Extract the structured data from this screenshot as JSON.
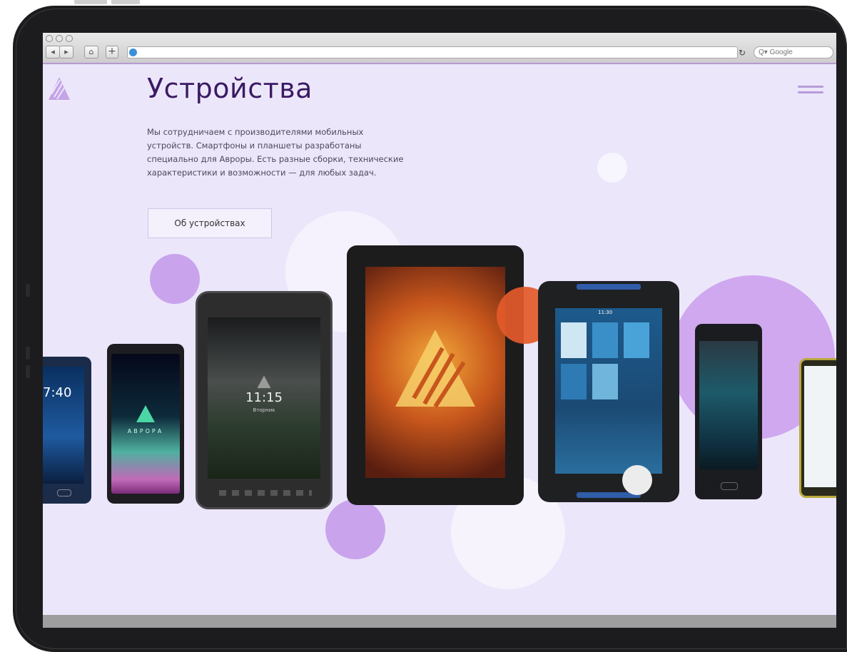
{
  "browser": {
    "search_placeholder": "Q▾ Google"
  },
  "page": {
    "title": "Устройства",
    "description": "Мы сотрудничаем с производителями мобильных устройств. Смартфоны и планшеты разработаны специально для Авроры. Есть разные сборки, технические характеристики и возможности — для любых задач.",
    "button_label": "Об устройствах"
  },
  "devices": {
    "phone1_time": "7:40",
    "phone2_brand": "АВРОРА",
    "tablet1_time": "11:15",
    "tablet1_date": "Вторник",
    "tablet3_time": "11:30"
  },
  "colors": {
    "page_bg": "#ece6fb",
    "title": "#3a1a63",
    "accent_purple": "#c9a3ec",
    "accent_orange": "#e45a2a"
  }
}
